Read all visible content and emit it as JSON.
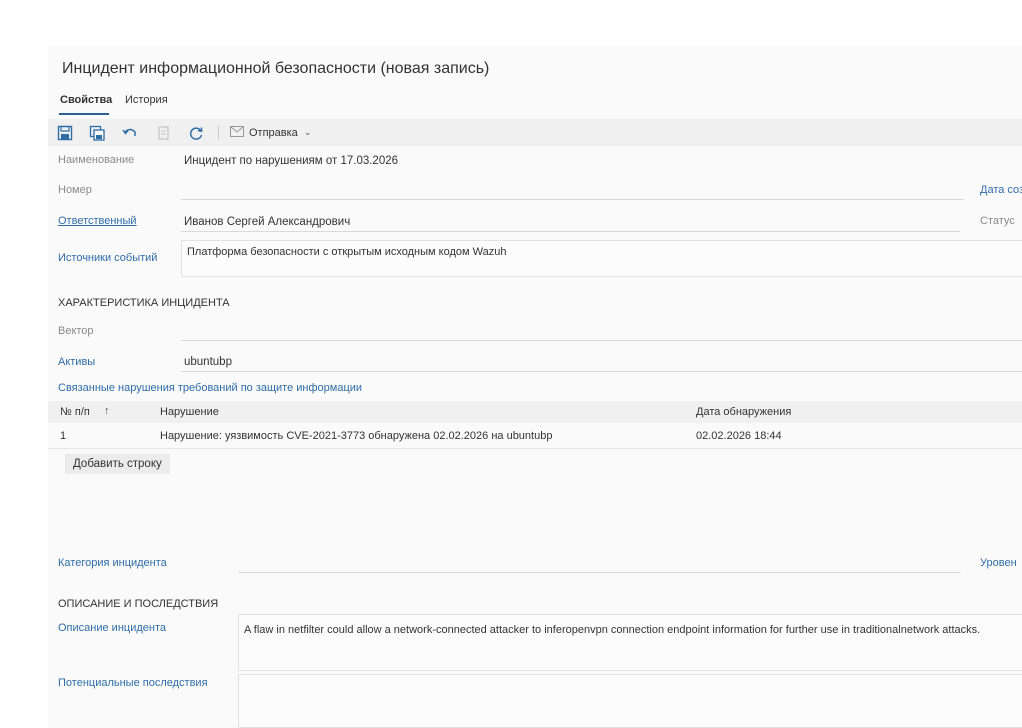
{
  "form": {
    "title": "Инцидент информационной безопасности (новая запись)",
    "tabs": [
      {
        "label": "Свойства",
        "active": true
      },
      {
        "label": "История",
        "active": false
      }
    ]
  },
  "toolbar": {
    "buttons": [
      "save-icon",
      "save-copy-icon",
      "undo-icon",
      "copy-document-icon",
      "refresh-icon"
    ],
    "dispatch_label": "Отправка"
  },
  "fields": {
    "name_label": "Наименование",
    "name_value": "Инцидент по нарушениям от 17.03.2026",
    "number_label": "Номер",
    "number_value": "",
    "created_date_label": "Дата соз",
    "responsible_label": "Ответственный",
    "responsible_value": "Иванов Сергей Александрович",
    "status_label": "Статус",
    "sources_label": "Источники событий",
    "sources_value": "Платформа безопасности с открытым исходным кодом Wazuh"
  },
  "characteristics": {
    "heading": "ХАРАКТЕРИСТИКА ИНЦИДЕНТА",
    "vector_label": "Вектор",
    "vector_value": "",
    "assets_label": "Активы",
    "assets_value": "ubuntubp",
    "violations_link": "Связанные нарушения требований по защите информации"
  },
  "violations_table": {
    "columns": [
      "№ п/п",
      "Нарушение",
      "Дата обнаружения"
    ],
    "rows": [
      {
        "num": "1",
        "violation": "Нарушение: уязвимость CVE-2021-3773 обнаружена 02.02.2026 на ubuntubp",
        "date": "02.02.2026 18:44"
      }
    ],
    "add_row_label": "Добавить строку"
  },
  "category": {
    "label": "Категория инцидента",
    "value": "",
    "level_label": "Уровен"
  },
  "description": {
    "heading": "ОПИСАНИЕ И ПОСЛЕДСТВИЯ",
    "desc_label": "Описание инцидента",
    "desc_value": "A flaw in netfilter could allow a network-connected attacker to inferopenvpn connection endpoint information for further use in traditionalnetwork attacks.",
    "consequences_label": "Потенциальные последствия",
    "consequences_value": ""
  },
  "colors": {
    "accent": "#2f6da8",
    "tab_underline": "#2f5f8f",
    "toolbar_bg": "#f0f0f0"
  }
}
